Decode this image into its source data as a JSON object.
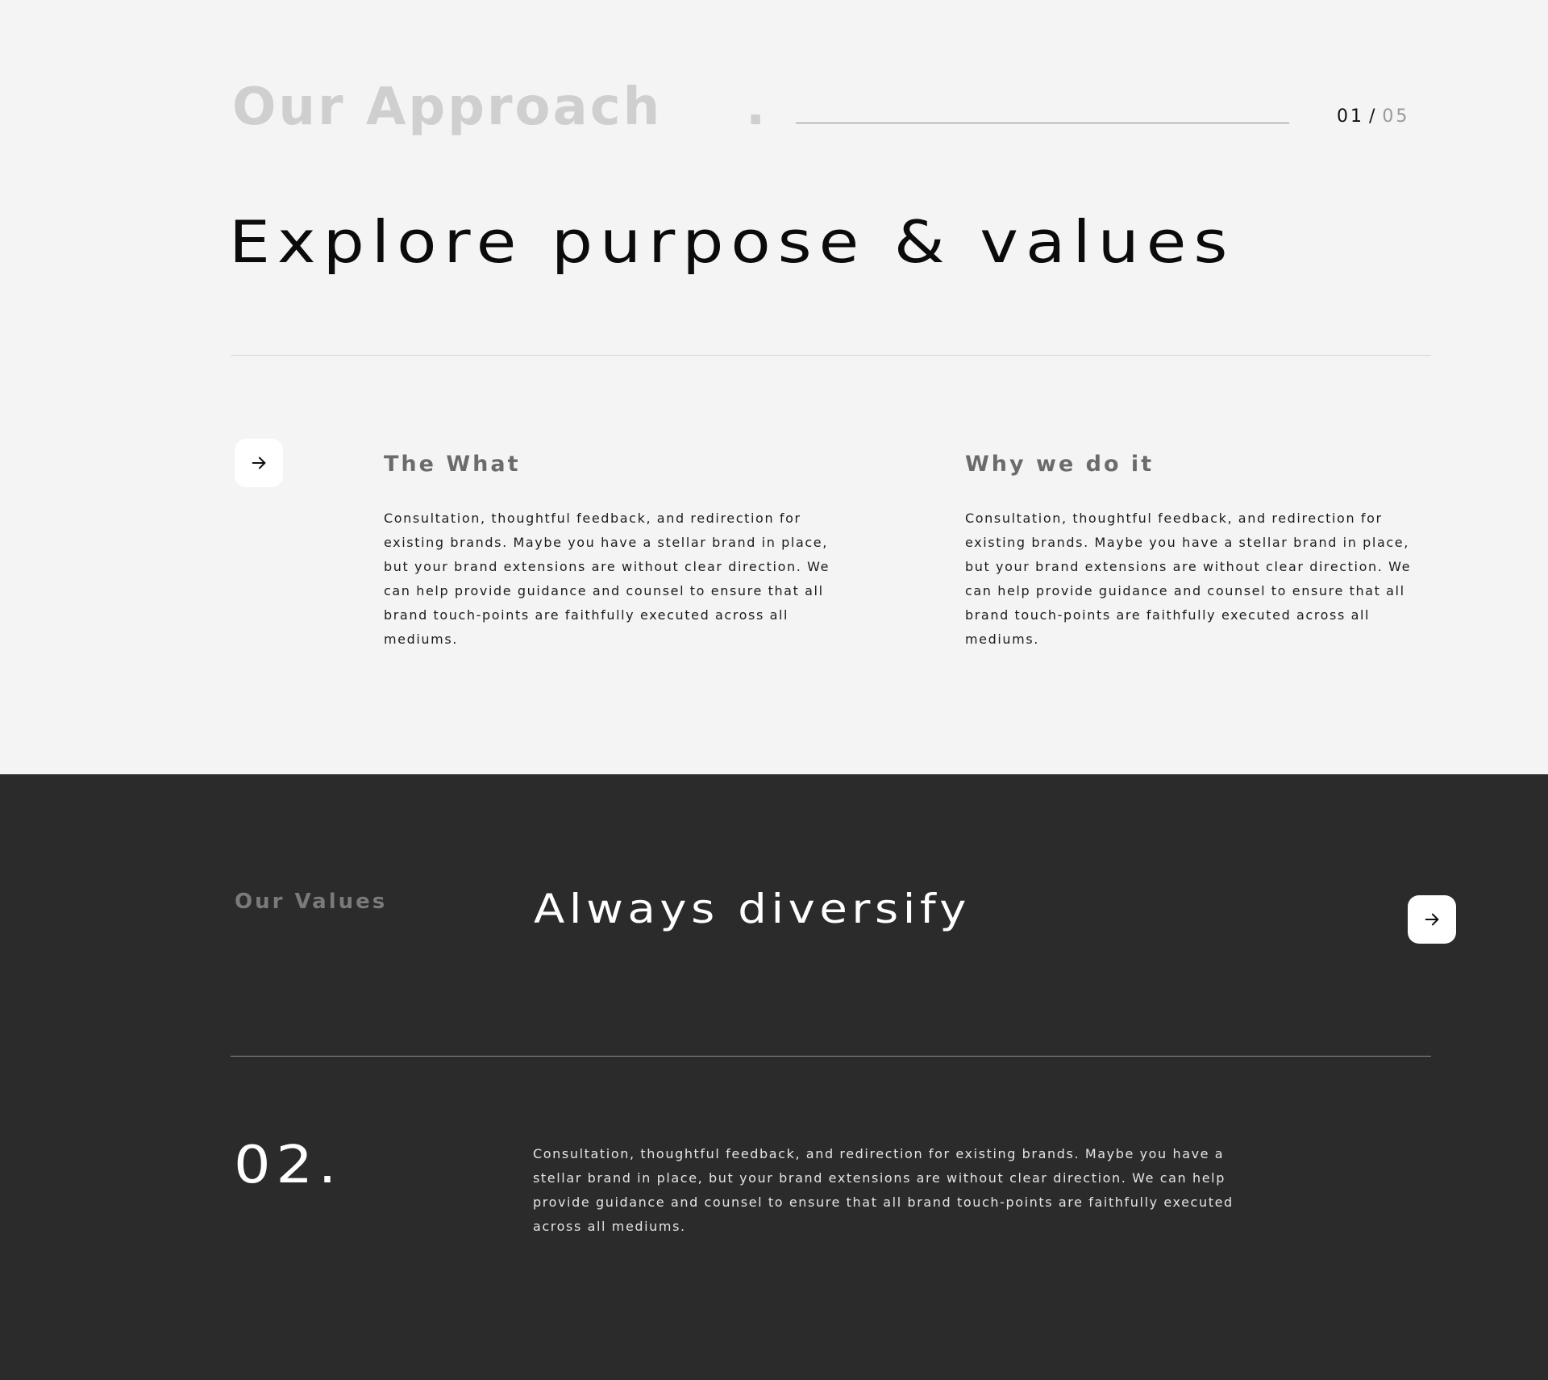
{
  "approach": {
    "title": "Our Approach",
    "title_dot": ".",
    "pager": {
      "current": "01",
      "separator": "/",
      "total": "05"
    },
    "headline": "Explore purpose & values",
    "columns": [
      {
        "title": "The What",
        "body": "Consultation, thoughtful feedback, and redirection for existing brands. Maybe you have a stellar brand in place, but your brand extensions are without clear direction. We can help provide guidance and counsel to ensure that all brand touch-points are faithfully executed across all mediums."
      },
      {
        "title": "Why we do it",
        "body": "Consultation, thoughtful feedback, and redirection for existing brands. Maybe you have a stellar brand in place, but your brand extensions are without clear direction. We can help provide guidance and counsel to ensure that all brand touch-points are faithfully executed across all mediums."
      }
    ],
    "arrow_icon": "arrow-right-icon"
  },
  "values": {
    "label": "Our Values",
    "title": "Always diversify",
    "arrow_icon": "arrow-right-icon",
    "number": "02.",
    "body": "Consultation, thoughtful feedback, and redirection for existing brands. Maybe you have a stellar brand in place, but your brand extensions are without clear direction. We can help provide guidance and counsel to ensure that all brand touch-points are faithfully executed across all mediums."
  },
  "colors": {
    "light_bg": "#f4f4f4",
    "dark_bg": "#2b2b2b",
    "muted_title": "#cfcfcf",
    "text_dark": "#0b0b0b",
    "text_light": "#ffffff"
  }
}
